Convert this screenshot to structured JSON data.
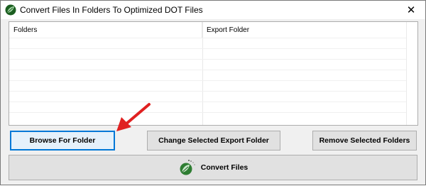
{
  "window": {
    "title": "Convert Files In Folders To Optimized DOT Files",
    "close_symbol": "✕"
  },
  "list": {
    "columns": [
      "Folders",
      "Export Folder"
    ],
    "rows": []
  },
  "buttons": {
    "browse": "Browse For Folder",
    "change_export": "Change Selected Export Folder",
    "remove": "Remove Selected Folders",
    "convert": "Convert Files"
  },
  "icons": {
    "app": "leaf-logo-icon",
    "convert": "leaf-logo-icon",
    "annotation": "red-arrow-icon"
  },
  "colors": {
    "accent_focus": "#0078d7",
    "leaf_green": "#2e7d32",
    "arrow_red": "#e02020"
  }
}
